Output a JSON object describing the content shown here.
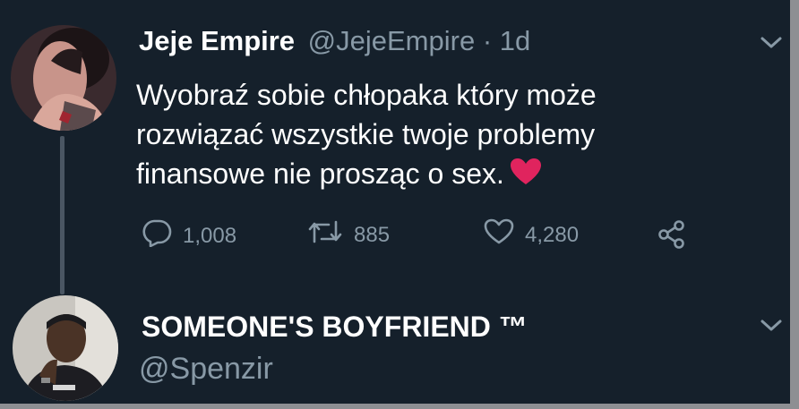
{
  "tweet": {
    "author_name": "Jeje Empire",
    "author_handle": "@JejeEmpire",
    "separator": "·",
    "time": "1d",
    "text": "Wyobraź sobie chłopaka który może rozwiązać wszystkie twoje problemy finansowe nie prosząc o sex.",
    "emoji": "heart-emoji",
    "stats": {
      "replies": "1,008",
      "retweets": "885",
      "likes": "4,280"
    }
  },
  "reply": {
    "author_name": "SOMEONE'S BOYFRIEND ™",
    "author_handle": "@Spenzir"
  },
  "colors": {
    "background": "#15202b",
    "text": "#ffffff",
    "muted": "#8899a6",
    "heart": "#e0245e"
  }
}
